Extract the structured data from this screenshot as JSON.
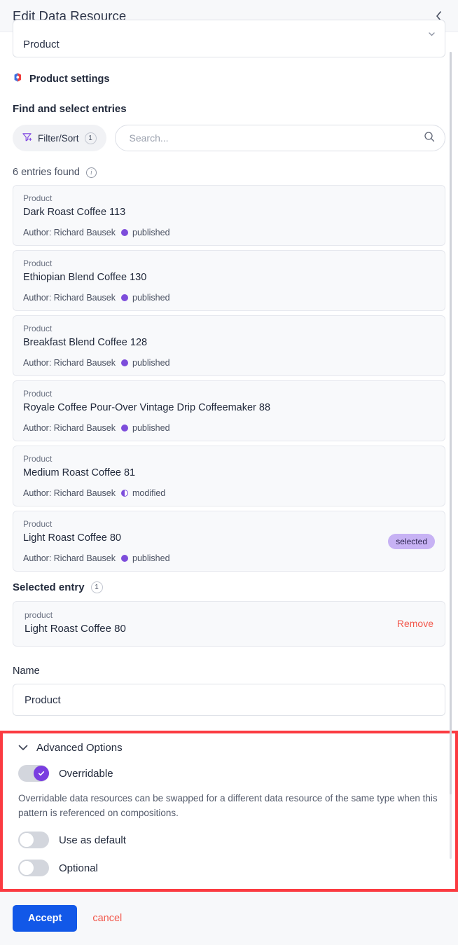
{
  "header": {
    "title": "Edit Data Resource",
    "collapse_icon": "chevron-left-icon"
  },
  "top_select": {
    "value": "Product",
    "caret_icon": "chevron-down-icon"
  },
  "settings": {
    "icon": "product-settings-icon",
    "label": "Product settings"
  },
  "find": {
    "title": "Find and select entries",
    "filter_label": "Filter/Sort",
    "filter_count": "1",
    "filter_icon": "filter-sort-icon",
    "search_placeholder": "Search...",
    "search_value": "",
    "search_icon": "search-icon"
  },
  "results": {
    "count_label": "6 entries found",
    "info_icon": "info-icon",
    "entries": [
      {
        "type": "Product",
        "title": "Dark Roast Coffee 113",
        "author": "Author: Richard Bausek",
        "status": "published",
        "status_kind": "published",
        "badge": ""
      },
      {
        "type": "Product",
        "title": "Ethiopian Blend Coffee 130",
        "author": "Author: Richard Bausek",
        "status": "published",
        "status_kind": "published",
        "badge": ""
      },
      {
        "type": "Product",
        "title": "Breakfast Blend Coffee 128",
        "author": "Author: Richard Bausek",
        "status": "published",
        "status_kind": "published",
        "badge": ""
      },
      {
        "type": "Product",
        "title": "Royale Coffee Pour-Over Vintage Drip Coffeemaker 88",
        "author": "Author: Richard Bausek",
        "status": "published",
        "status_kind": "published",
        "badge": ""
      },
      {
        "type": "Product",
        "title": "Medium Roast Coffee 81",
        "author": "Author: Richard Bausek",
        "status": "modified",
        "status_kind": "modified",
        "badge": ""
      },
      {
        "type": "Product",
        "title": "Light Roast Coffee 80",
        "author": "Author: Richard Bausek",
        "status": "published",
        "status_kind": "published",
        "badge": "selected"
      }
    ]
  },
  "selected": {
    "title": "Selected entry",
    "count": "1",
    "entry_type": "product",
    "entry_title": "Light Roast Coffee 80",
    "remove_label": "Remove"
  },
  "name_field": {
    "label": "Name",
    "value": "Product",
    "placeholder": ""
  },
  "advanced": {
    "title": "Advanced Options",
    "chevron_icon": "chevron-down-icon",
    "overridable_label": "Overridable",
    "overridable_on": true,
    "description": "Overridable data resources can be swapped for a different data resource of the same type when this pattern is referenced on compositions.",
    "use_as_default_label": "Use as default",
    "use_as_default_on": false,
    "optional_label": "Optional",
    "optional_on": false
  },
  "footer": {
    "accept_label": "Accept",
    "cancel_label": "cancel"
  },
  "colors": {
    "accent_blue": "#1258e8",
    "purple": "#7a3ee0",
    "badge_purple": "#c7b2f4",
    "danger_red": "#f2574b",
    "highlight_red": "#fb3b41"
  }
}
